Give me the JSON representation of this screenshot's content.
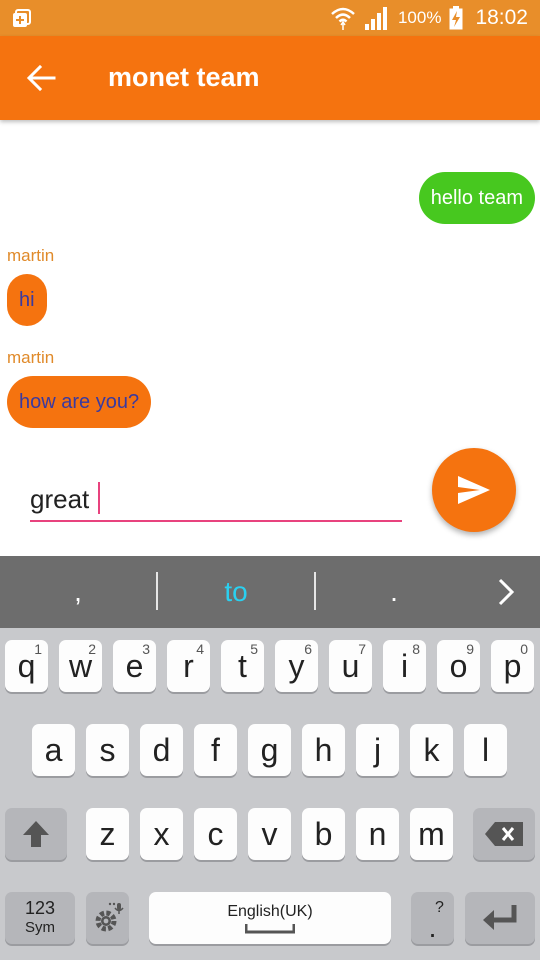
{
  "status_bar": {
    "battery_pct": "100%",
    "time": "18:02",
    "bg_color": "#e88e2a"
  },
  "app_bar": {
    "title": "monet team",
    "color": "#f5730f"
  },
  "messages": [
    {
      "side": "out",
      "text": "hello team",
      "color": "#47c81f"
    },
    {
      "side": "in",
      "sender": "martin",
      "text": "hi",
      "color": "#f5730f"
    },
    {
      "side": "in",
      "sender": "martin",
      "text": "how are you?",
      "color": "#f5730f"
    }
  ],
  "composer": {
    "value": "great",
    "send_icon": "send-icon"
  },
  "keyboard": {
    "suggestions": [
      ",",
      "to",
      "."
    ],
    "row1": [
      {
        "k": "q",
        "n": "1"
      },
      {
        "k": "w",
        "n": "2"
      },
      {
        "k": "e",
        "n": "3"
      },
      {
        "k": "r",
        "n": "4"
      },
      {
        "k": "t",
        "n": "5"
      },
      {
        "k": "y",
        "n": "6"
      },
      {
        "k": "u",
        "n": "7"
      },
      {
        "k": "i",
        "n": "8"
      },
      {
        "k": "o",
        "n": "9"
      },
      {
        "k": "p",
        "n": "0"
      }
    ],
    "row2": [
      "a",
      "s",
      "d",
      "f",
      "g",
      "h",
      "j",
      "k",
      "l"
    ],
    "row3": [
      "z",
      "x",
      "c",
      "v",
      "b",
      "n",
      "m"
    ],
    "sym_top": "123",
    "sym_bottom": "Sym",
    "space_label": "English(UK)",
    "punct_key": "?",
    "punct_dot": "."
  }
}
